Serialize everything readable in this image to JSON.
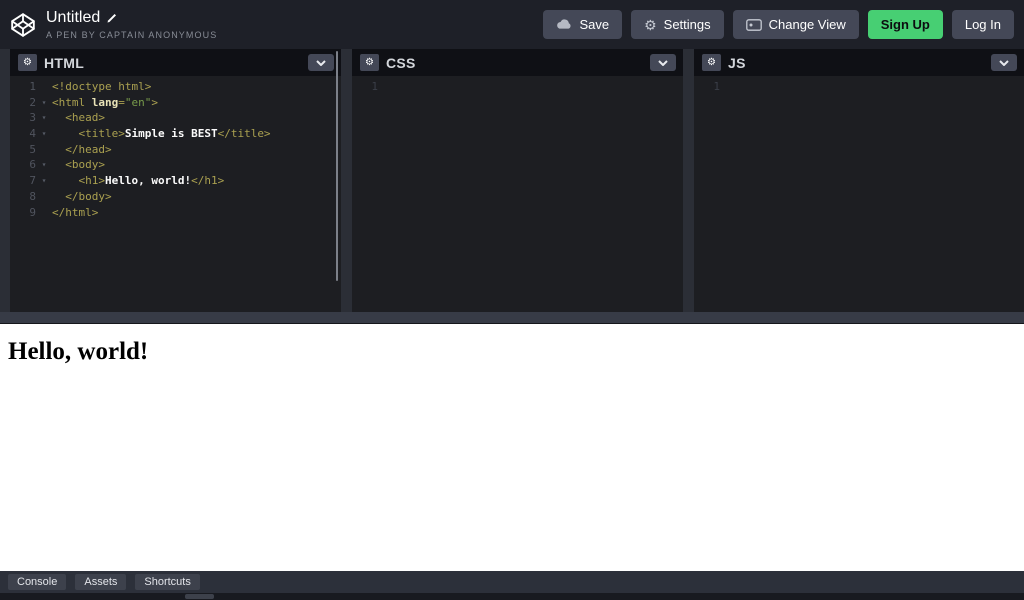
{
  "header": {
    "title": "Untitled",
    "subtitle": "A PEN BY CAPTAIN ANONYMOUS",
    "actions": {
      "save": "Save",
      "settings": "Settings",
      "change_view": "Change View",
      "sign_up": "Sign Up",
      "log_in": "Log In"
    }
  },
  "colors": {
    "header_bg": "#1e2028",
    "button_bg": "#444857",
    "accent_green": "#47cf73",
    "editor_bg": "#1d1e22",
    "panel_header_bg": "#0f1015",
    "footer_bg": "#2c303a",
    "syntax_tag": "#aaa050",
    "syntax_attr": "#e9e3b8",
    "syntax_string": "#789b4b",
    "syntax_text": "#fbfbfb"
  },
  "panels": [
    {
      "id": "html",
      "label": "HTML",
      "lines": [
        {
          "n": 1,
          "fold": false,
          "tokens": [
            {
              "c": "tag",
              "v": "<!doctype html>"
            }
          ]
        },
        {
          "n": 2,
          "fold": true,
          "tokens": [
            {
              "c": "tag",
              "v": "<html "
            },
            {
              "c": "attr",
              "v": "lang"
            },
            {
              "c": "tag",
              "v": "="
            },
            {
              "c": "str",
              "v": "\"en\""
            },
            {
              "c": "tag",
              "v": ">"
            }
          ]
        },
        {
          "n": 3,
          "fold": true,
          "tokens": [
            {
              "c": "tag",
              "v": "  <head>"
            }
          ]
        },
        {
          "n": 4,
          "fold": true,
          "tokens": [
            {
              "c": "tag",
              "v": "    <title>"
            },
            {
              "c": "text",
              "v": "Simple is BEST"
            },
            {
              "c": "tag",
              "v": "</title>"
            }
          ]
        },
        {
          "n": 5,
          "fold": false,
          "tokens": [
            {
              "c": "tag",
              "v": "  </head>"
            }
          ]
        },
        {
          "n": 6,
          "fold": true,
          "tokens": [
            {
              "c": "tag",
              "v": "  <body>"
            }
          ]
        },
        {
          "n": 7,
          "fold": true,
          "tokens": [
            {
              "c": "tag",
              "v": "    <h1>"
            },
            {
              "c": "text",
              "v": "Hello, world!"
            },
            {
              "c": "tag",
              "v": "</h1>"
            }
          ]
        },
        {
          "n": 8,
          "fold": false,
          "tokens": [
            {
              "c": "tag",
              "v": "  </body>"
            }
          ]
        },
        {
          "n": 9,
          "fold": false,
          "tokens": [
            {
              "c": "tag",
              "v": "</html>"
            }
          ]
        }
      ]
    },
    {
      "id": "css",
      "label": "CSS",
      "lines": [
        {
          "n": 1,
          "fold": false,
          "tokens": []
        }
      ]
    },
    {
      "id": "js",
      "label": "JS",
      "lines": [
        {
          "n": 1,
          "fold": false,
          "tokens": []
        }
      ]
    }
  ],
  "preview": {
    "heading": "Hello, world!"
  },
  "footer": {
    "console": "Console",
    "assets": "Assets",
    "shortcuts": "Shortcuts"
  }
}
